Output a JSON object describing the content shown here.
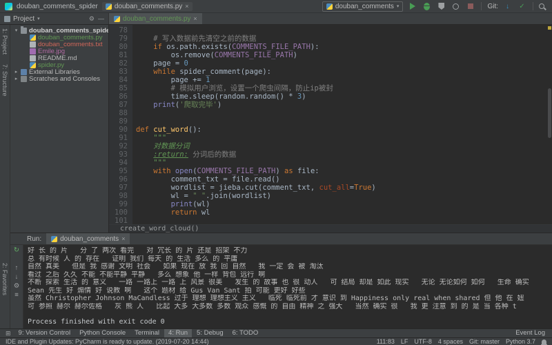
{
  "titlebar": {
    "project_title": "douban_comments_spider",
    "file_chip": "douban_comments.py",
    "run_config": "douban_comments",
    "git_label": "Git:"
  },
  "navbar": {
    "project_dropdown": "Project",
    "editor_tab": "douban_comments.py"
  },
  "tool_strips": {
    "project": "1: Project",
    "structure": "7: Structure",
    "favorites": "2: Favorites"
  },
  "project_tree": {
    "items": [
      {
        "label": "douban_comments_spider",
        "type": "folder",
        "indent": 0,
        "arrow": "down",
        "color": "#d0d0d0",
        "bold": true
      },
      {
        "label": "douban_comments.py",
        "type": "python",
        "indent": 1,
        "arrow": "",
        "color": "#629755",
        "bold": false
      },
      {
        "label": "douban_comments.txt",
        "type": "text",
        "indent": 1,
        "arrow": "",
        "color": "#d1675a",
        "bold": false
      },
      {
        "label": "Emile.jpg",
        "type": "image",
        "indent": 1,
        "arrow": "",
        "color": "#b26ba2",
        "bold": false
      },
      {
        "label": "README.md",
        "type": "text",
        "indent": 1,
        "arrow": "",
        "color": "#bbbbbb",
        "bold": false
      },
      {
        "label": "spider.py",
        "type": "python",
        "indent": 1,
        "arrow": "",
        "color": "#629755",
        "bold": false
      },
      {
        "label": "External Libraries",
        "type": "library",
        "indent": 0,
        "arrow": "right",
        "color": "#bbbbbb",
        "bold": false
      },
      {
        "label": "Scratches and Consoles",
        "type": "scratch",
        "indent": 0,
        "arrow": "right",
        "color": "#bbbbbb",
        "bold": false
      }
    ]
  },
  "editor": {
    "lines": [
      {
        "no": "78",
        "seg": []
      },
      {
        "no": "79",
        "seg": [
          [
            "cm",
            "    # 写入数据前先清空之前的数据"
          ]
        ]
      },
      {
        "no": "80",
        "seg": [
          [
            "pl",
            "    "
          ],
          [
            "kw",
            "if"
          ],
          [
            "pl",
            " os.path.exists("
          ],
          [
            "cn",
            "COMMENTS_FILE_PATH"
          ],
          [
            "pl",
            "):"
          ]
        ]
      },
      {
        "no": "81",
        "seg": [
          [
            "pl",
            "        os.remove("
          ],
          [
            "cn",
            "COMMENTS_FILE_PATH"
          ],
          [
            "pl",
            ")"
          ]
        ]
      },
      {
        "no": "82",
        "seg": [
          [
            "pl",
            "    page = "
          ],
          [
            "nm",
            "0"
          ]
        ]
      },
      {
        "no": "83",
        "seg": [
          [
            "pl",
            "    "
          ],
          [
            "kw",
            "while"
          ],
          [
            "pl",
            " spider_comment(page):"
          ]
        ]
      },
      {
        "no": "84",
        "seg": [
          [
            "pl",
            "        page += "
          ],
          [
            "nm",
            "1"
          ]
        ]
      },
      {
        "no": "85",
        "seg": [
          [
            "cm",
            "        # 模拟用户浏览，设置一个爬虫间隔，防止ip被封"
          ]
        ]
      },
      {
        "no": "86",
        "seg": [
          [
            "pl",
            "        time.sleep(random.random() * "
          ],
          [
            "nm",
            "3"
          ],
          [
            "pl",
            ")"
          ]
        ]
      },
      {
        "no": "87",
        "seg": [
          [
            "pl",
            "    "
          ],
          [
            "bi",
            "print"
          ],
          [
            "pl",
            "("
          ],
          [
            "st",
            "'爬取完毕'"
          ],
          [
            "pl",
            ")"
          ]
        ]
      },
      {
        "no": "88",
        "seg": []
      },
      {
        "no": "89",
        "seg": []
      },
      {
        "no": "90",
        "seg": [
          [
            "kw",
            "def "
          ],
          [
            "fn",
            "cut_word"
          ],
          [
            "pl",
            "():"
          ]
        ]
      },
      {
        "no": "91",
        "seg": [
          [
            "dc",
            "    \"\"\""
          ]
        ]
      },
      {
        "no": "92",
        "seg": [
          [
            "dc",
            "    对数据分词"
          ]
        ]
      },
      {
        "no": "93",
        "seg": [
          [
            "pl",
            "    "
          ],
          [
            "dt",
            ":return:"
          ],
          [
            "cm",
            " 分词后的数据"
          ]
        ]
      },
      {
        "no": "94",
        "seg": [
          [
            "dc",
            "    \"\"\""
          ]
        ]
      },
      {
        "no": "95",
        "seg": [
          [
            "pl",
            "    "
          ],
          [
            "kw",
            "with"
          ],
          [
            "pl",
            " "
          ],
          [
            "bi",
            "open"
          ],
          [
            "pl",
            "("
          ],
          [
            "cn",
            "COMMENTS_FILE_PATH"
          ],
          [
            "pl",
            ") "
          ],
          [
            "kw",
            "as"
          ],
          [
            "pl",
            " file:"
          ]
        ]
      },
      {
        "no": "96",
        "seg": [
          [
            "pl",
            "        comment_txt = file.read()"
          ]
        ]
      },
      {
        "no": "97",
        "seg": [
          [
            "pl",
            "        "
          ],
          [
            "ul",
            "wordlist"
          ],
          [
            "pl",
            " = jieba.cut(comment_txt, "
          ],
          [
            "pm",
            "cut_all"
          ],
          [
            "pl",
            "="
          ],
          [
            "kw",
            "True"
          ],
          [
            "pl",
            ")"
          ]
        ]
      },
      {
        "no": "98",
        "seg": [
          [
            "pl",
            "        wl = "
          ],
          [
            "st",
            "\" \""
          ],
          [
            "pl",
            ".join(wordlist)"
          ]
        ]
      },
      {
        "no": "99",
        "seg": [
          [
            "pl",
            "        "
          ],
          [
            "bi",
            "print"
          ],
          [
            "pl",
            "(wl)"
          ]
        ]
      },
      {
        "no": "100",
        "seg": [
          [
            "pl",
            "        "
          ],
          [
            "kw",
            "return"
          ],
          [
            "pl",
            " wl"
          ]
        ]
      },
      {
        "no": "101",
        "seg": []
      }
    ],
    "partial_line": "create_word_cloud()"
  },
  "run_panel": {
    "label": "Run:",
    "tab": "douban_comments",
    "output": [
      "好 长 的 片   分 了 两次 看完   对 冗长 的 片 还是 招架 不力",
      "总 有时候 人 的 存在   证明 我们 每天 的 生活 多么 的 平庸",
      "自然 真美   但是 我 感谢 文明 社会   如果 现在 放 我 回 自然   我 一定 会 被 淘汰",
      "看过 之后 久久 不能 不能平静 平静   多么 想象 他 一样 背包 远行 啊",
      "不断 探索 生活 的 意义   一路 一路上 一路 上 风景 很美   发生 的 故事 也 很 动人   可 结局 却是 如此 现实   无论 无论如何 如何   生命 确实",
      "Sean 先生 好 煽情 好 说教 啊   这个 题材 给 Gus Van Sant 拍 可能 更好 好些",
      "虽然 Christopher Johnson MaCandless 过于 理想 理想主义 主义   临死 临死前 才 意识 到 Happiness only real when shared 但 他 在 妞",
      "可 参照 赫尔 赫尔佐格   灰 熊 人   比起 大多 大多数 多数 观众 感慨 的 自由 精神 之 强大   当然 确实 很   我 更 注意 到 的 是 当 各种 t"
    ],
    "exit_line": "Process finished with exit code 0"
  },
  "bottom_tabs": {
    "left": [
      {
        "label": "9: Version Control",
        "active": false
      },
      {
        "label": "Python Console",
        "active": false
      },
      {
        "label": "Terminal",
        "active": false
      },
      {
        "label": "4: Run",
        "active": true
      },
      {
        "label": "5: Debug",
        "active": false
      },
      {
        "label": "6: TODO",
        "active": false
      }
    ],
    "right": [
      {
        "label": "Event Log",
        "active": false
      }
    ]
  },
  "statusbar": {
    "message": "IDE and Plugin Updates: PyCharm is ready to update. (2019-07-20 14:44)",
    "items": [
      "111:83",
      "LF",
      "UTF-8",
      "4 spaces",
      "Git: master",
      "Python 3.7"
    ]
  }
}
